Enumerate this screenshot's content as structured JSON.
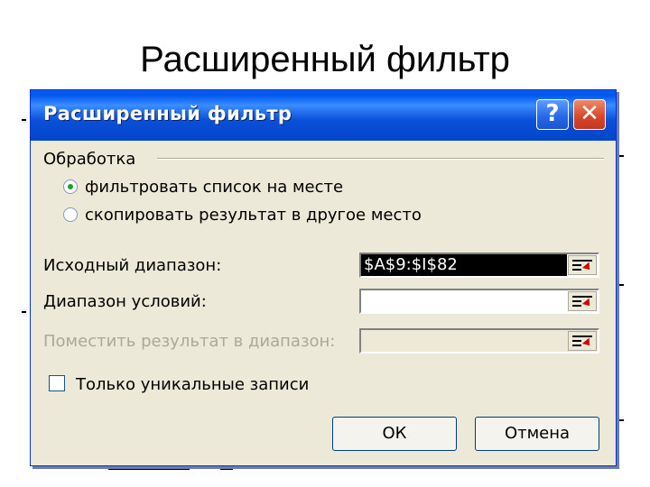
{
  "slide": {
    "title": "Расширенный фильтр"
  },
  "dialog": {
    "title": "Расширенный фильтр",
    "help_label": "?",
    "close_label": "✕",
    "group": {
      "label": "Обработка",
      "options": [
        {
          "label": "фильтровать список на месте",
          "selected": true
        },
        {
          "label": "скопировать результат в другое место",
          "selected": false
        }
      ]
    },
    "fields": [
      {
        "label": "Исходный диапазон:",
        "value": "$A$9:$I$82",
        "enabled": true
      },
      {
        "label": "Диапазон условий:",
        "value": "",
        "enabled": true
      },
      {
        "label": "Поместить результат в диапазон:",
        "value": "",
        "enabled": false
      }
    ],
    "unique_only": {
      "label": "Только уникальные записи",
      "checked": false
    },
    "ok_label": "ОК",
    "cancel_label": "Отмена"
  },
  "colors": {
    "titlebar": "#0a4fd8",
    "dialog_bg": "#ece9d8",
    "close_button": "#d6452a",
    "radio_dot": "#21a121",
    "collapse_arrow": "#d40000"
  },
  "icons": [
    "help-icon",
    "close-icon",
    "collapse-range-icon"
  ]
}
